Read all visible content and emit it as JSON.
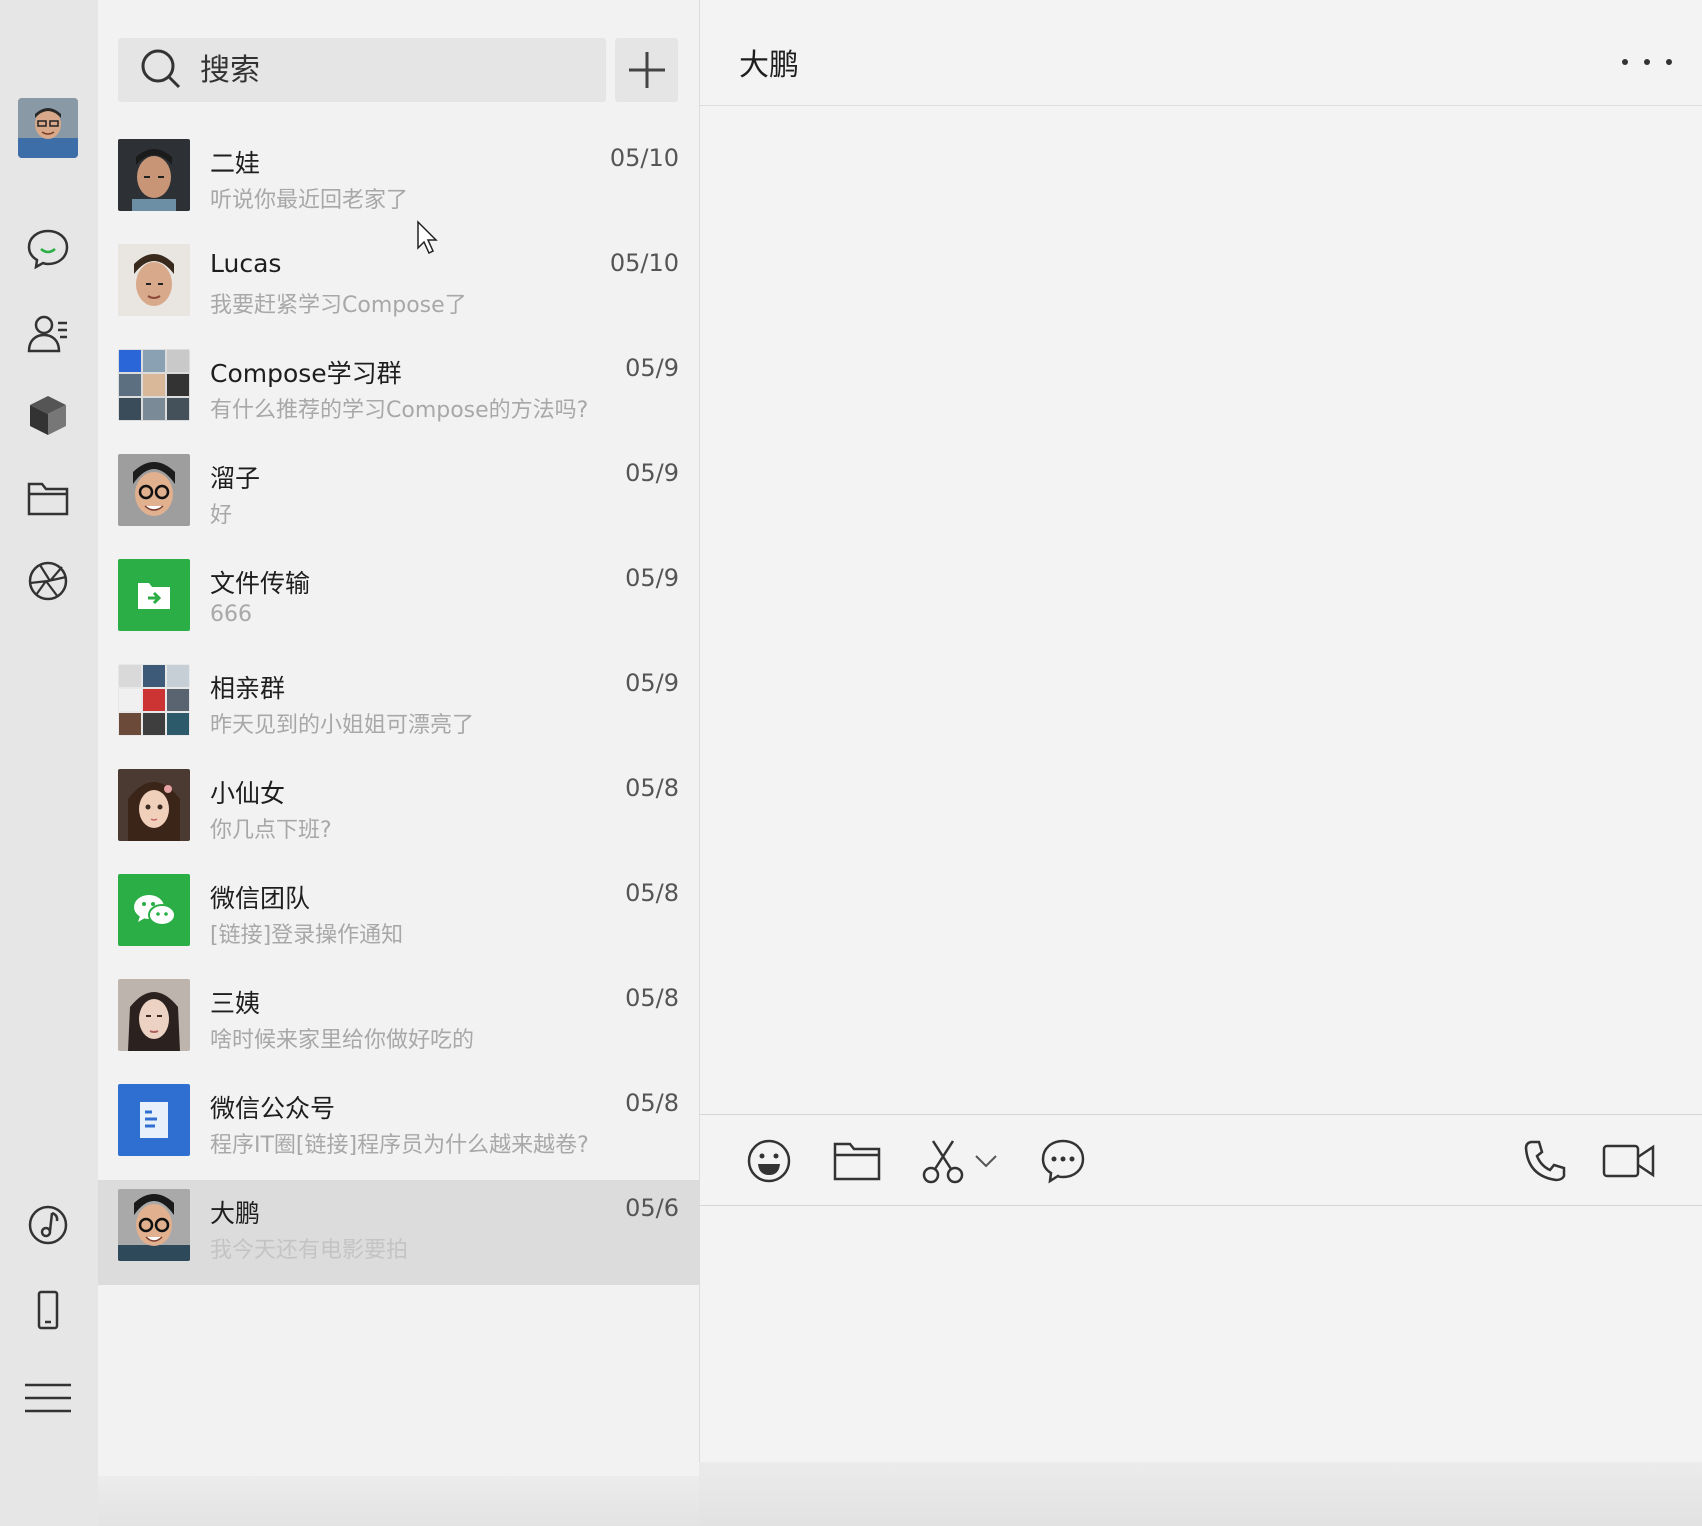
{
  "app": {
    "name": "WeChat"
  },
  "colors": {
    "accent_green": "#2aae45",
    "active_row": "#dcdcdc",
    "rail_bg": "#e6e6e6",
    "list_bg": "#f2f2f2",
    "preview_text": "#a8a8a8"
  },
  "rail": {
    "items": [
      {
        "icon": "chat-bubble-icon"
      },
      {
        "icon": "contacts-icon"
      },
      {
        "icon": "cube-icon"
      },
      {
        "icon": "folder-icon"
      },
      {
        "icon": "aperture-icon"
      },
      {
        "icon": "music-disc-icon"
      },
      {
        "icon": "phone-device-icon"
      },
      {
        "icon": "menu-icon"
      }
    ]
  },
  "search": {
    "placeholder": "搜索",
    "value": ""
  },
  "chats": [
    {
      "name": "二娃",
      "preview": "听说你最近回老家了",
      "date": "05/10"
    },
    {
      "name": "Lucas",
      "preview": "我要赶紧学习Compose了",
      "date": "05/10"
    },
    {
      "name": "Compose学习群",
      "preview": "有什么推荐的学习Compose的方法吗?",
      "date": "05/9"
    },
    {
      "name": "溜子",
      "preview": "好",
      "date": "05/9"
    },
    {
      "name": "文件传输",
      "preview": "666",
      "date": "05/9"
    },
    {
      "name": "相亲群",
      "preview": "昨天见到的小姐姐可漂亮了",
      "date": "05/9"
    },
    {
      "name": "小仙女",
      "preview": "你几点下班?",
      "date": "05/8"
    },
    {
      "name": "微信团队",
      "preview": "[链接]登录操作通知",
      "date": "05/8"
    },
    {
      "name": "三姨",
      "preview": "啥时候来家里给你做好吃的",
      "date": "05/8"
    },
    {
      "name": "微信公众号",
      "preview": "程序IT圈[链接]程序员为什么越来越卷?",
      "date": "05/8"
    },
    {
      "name": "大鹏",
      "preview": "我今天还有电影要拍",
      "date": "05/6"
    }
  ],
  "conversation": {
    "title": "大鹏",
    "toolbar": [
      "emoji-icon",
      "folder-icon",
      "scissors-icon",
      "chat-dots-icon",
      "phone-icon",
      "video-icon"
    ]
  }
}
